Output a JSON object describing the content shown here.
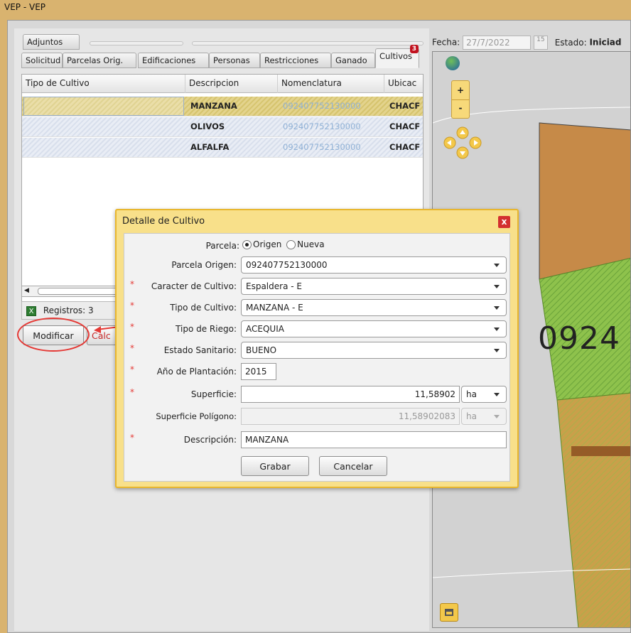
{
  "window": {
    "title": "VEP - VEP"
  },
  "tabs_top": [
    {
      "label": "Adjuntos"
    }
  ],
  "tabs": [
    {
      "label": "Solicitud"
    },
    {
      "label": "Parcelas Orig."
    },
    {
      "label": "Edificaciones"
    },
    {
      "label": "Personas"
    },
    {
      "label": "Restricciones"
    },
    {
      "label": "Ganado"
    },
    {
      "label": "Cultivos",
      "badge": "3"
    }
  ],
  "header": {
    "fecha_label": "Fecha:",
    "fecha_value": "27/7/2022",
    "calendar_day": "15",
    "estado_label": "Estado:",
    "estado_value": "Iniciad"
  },
  "grid": {
    "columns": [
      "Tipo de Cultivo",
      "Descripcion",
      "Nomenclatura",
      "Ubicac"
    ],
    "rows": [
      {
        "tipo": "",
        "descripcion": "MANZANA",
        "nomenclatura": "092407752130000",
        "ubicacion": "CHACF"
      },
      {
        "tipo": "",
        "descripcion": "OLIVOS",
        "nomenclatura": "092407752130000",
        "ubicacion": "CHACF"
      },
      {
        "tipo": "",
        "descripcion": "ALFALFA",
        "nomenclatura": "092407752130000",
        "ubicacion": "CHACF"
      }
    ],
    "registros_label": "Registros: 3"
  },
  "actions": {
    "modificar": "Modificar",
    "calc_partial": "Calc"
  },
  "map": {
    "parcel_label": "0924",
    "zoom_in": "+",
    "zoom_out": "-"
  },
  "dialog": {
    "title": "Detalle de Cultivo",
    "close": "x",
    "parcela_label": "Parcela:",
    "parcela_opt1": "Origen",
    "parcela_opt2": "Nueva",
    "parcela_origen_label": "Parcela Origen:",
    "parcela_origen_value": "092407752130000",
    "caracter_label": "Caracter de Cultivo:",
    "caracter_value": "Espaldera - E",
    "tipo_label": "Tipo de Cultivo:",
    "tipo_value": "MANZANA - E",
    "riego_label": "Tipo de Riego:",
    "riego_value": "ACEQUIA",
    "sanitario_label": "Estado Sanitario:",
    "sanitario_value": "BUENO",
    "anio_label": "Año de Plantación:",
    "anio_value": "2015",
    "superficie_label": "Superficie:",
    "superficie_value": "11,58902",
    "superficie_unit": "ha",
    "sup_poligono_label": "Superficie Polígono:",
    "sup_poligono_value": "11,58902083",
    "sup_poligono_unit": "ha",
    "descripcion_label": "Descripción:",
    "descripcion_value": "MANZANA",
    "grabar": "Grabar",
    "cancelar": "Cancelar",
    "required_mark": "*"
  },
  "colors": {
    "accent": "#d9b36f",
    "dialog_border": "#e8b62d",
    "required": "#e53935"
  }
}
